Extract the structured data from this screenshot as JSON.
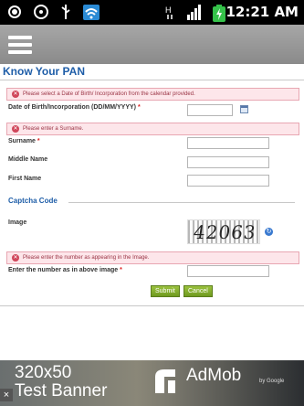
{
  "status_bar": {
    "time": "12:21 AM"
  },
  "page": {
    "title": "Know Your PAN"
  },
  "errors": {
    "dob": "Please select a Date of Birth/ Incorporation from the calendar provided.",
    "surname": "Please enter a Surname.",
    "captcha": "Please enter the number as appearing in the Image."
  },
  "form": {
    "dob_label": "Date of Birth/Incorporation (DD/MM/YYYY)",
    "dob_value": "",
    "surname_label": "Surname",
    "surname_value": "",
    "middle_name_label": "Middle Name",
    "middle_name_value": "",
    "first_name_label": "First Name",
    "first_name_value": "",
    "required_marker": "*"
  },
  "captcha_section": {
    "heading": "Captcha Code",
    "image_label": "Image",
    "captcha_text": "42063",
    "number_label": "Enter the number as in above image",
    "number_value": ""
  },
  "buttons": {
    "submit": "Submit",
    "cancel": "Cancel"
  },
  "ad": {
    "line1": "320x50",
    "line2": "Test Banner",
    "brand": "AdMob",
    "by": "by Google",
    "close": "×"
  }
}
